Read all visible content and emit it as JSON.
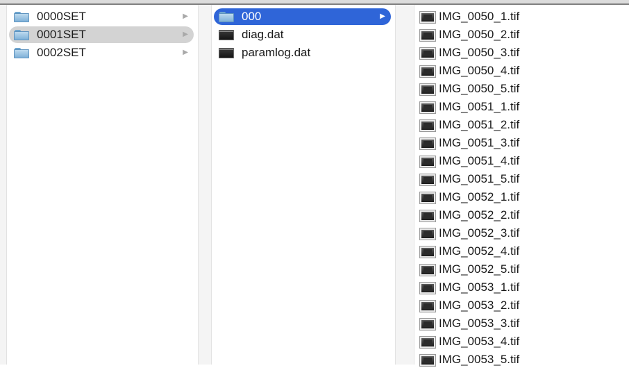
{
  "columns": [
    {
      "items": [
        {
          "label": "0000SET",
          "kind": "folder",
          "state": "normal",
          "has_children": true
        },
        {
          "label": "0001SET",
          "kind": "folder",
          "state": "selected-inactive",
          "has_children": true
        },
        {
          "label": "0002SET",
          "kind": "folder",
          "state": "normal",
          "has_children": true
        }
      ]
    },
    {
      "items": [
        {
          "label": "000",
          "kind": "folder",
          "state": "selected-active",
          "has_children": true
        },
        {
          "label": "diag.dat",
          "kind": "file",
          "state": "normal",
          "has_children": false
        },
        {
          "label": "paramlog.dat",
          "kind": "file",
          "state": "normal",
          "has_children": false
        }
      ]
    },
    {
      "items": [
        {
          "label": "IMG_0050_1.tif",
          "kind": "image"
        },
        {
          "label": "IMG_0050_2.tif",
          "kind": "image"
        },
        {
          "label": "IMG_0050_3.tif",
          "kind": "image"
        },
        {
          "label": "IMG_0050_4.tif",
          "kind": "image"
        },
        {
          "label": "IMG_0050_5.tif",
          "kind": "image"
        },
        {
          "label": "IMG_0051_1.tif",
          "kind": "image"
        },
        {
          "label": "IMG_0051_2.tif",
          "kind": "image"
        },
        {
          "label": "IMG_0051_3.tif",
          "kind": "image"
        },
        {
          "label": "IMG_0051_4.tif",
          "kind": "image"
        },
        {
          "label": "IMG_0051_5.tif",
          "kind": "image"
        },
        {
          "label": "IMG_0052_1.tif",
          "kind": "image"
        },
        {
          "label": "IMG_0052_2.tif",
          "kind": "image"
        },
        {
          "label": "IMG_0052_3.tif",
          "kind": "image"
        },
        {
          "label": "IMG_0052_4.tif",
          "kind": "image"
        },
        {
          "label": "IMG_0052_5.tif",
          "kind": "image"
        },
        {
          "label": "IMG_0053_1.tif",
          "kind": "image"
        },
        {
          "label": "IMG_0053_2.tif",
          "kind": "image"
        },
        {
          "label": "IMG_0053_3.tif",
          "kind": "image"
        },
        {
          "label": "IMG_0053_4.tif",
          "kind": "image"
        },
        {
          "label": "IMG_0053_5.tif",
          "kind": "image"
        }
      ]
    }
  ],
  "icons": {
    "folder": "folder-icon",
    "file": "file-icon",
    "image": "image-file-icon",
    "disclosure": "disclosure-arrow-icon"
  },
  "glyphs": {
    "disclosure": "▶"
  },
  "colors": {
    "selection_active": "#2f65d8",
    "selection_inactive": "#d3d3d3",
    "text": "#1a1a1a"
  }
}
